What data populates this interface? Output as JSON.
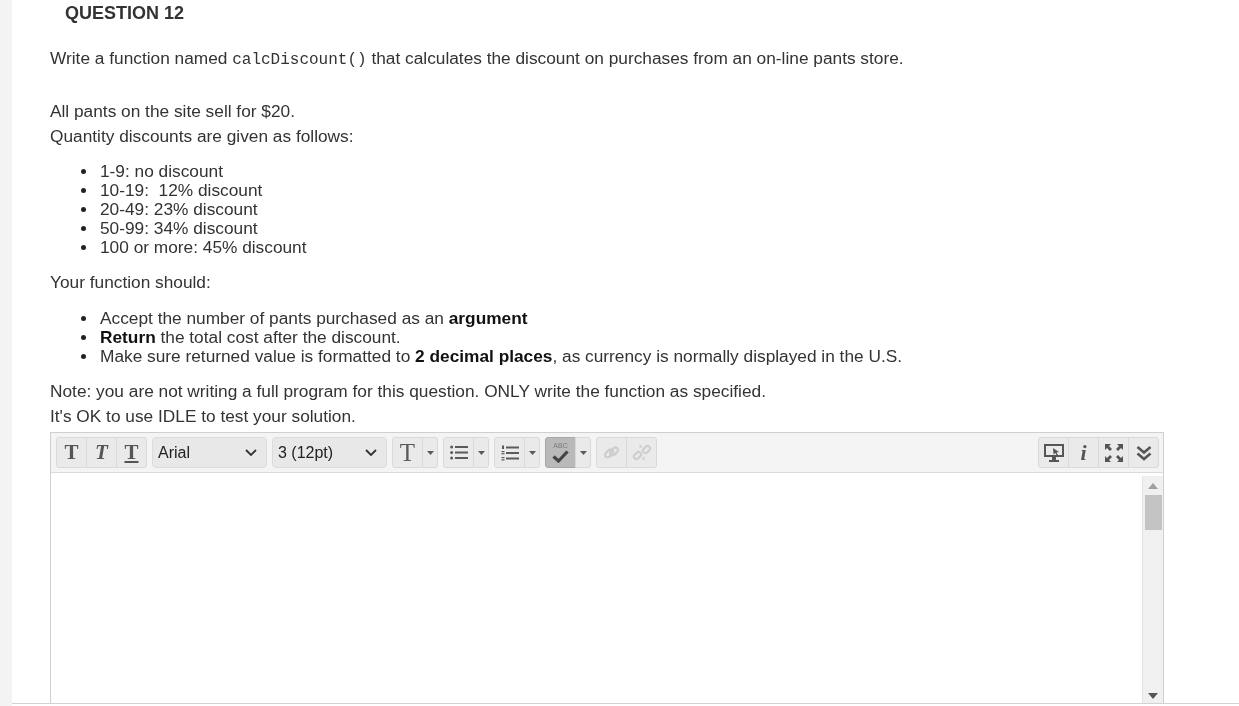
{
  "question": {
    "title": "QUESTION 12",
    "prompt": [
      {
        "kind": "text",
        "text": "Write a function named "
      },
      {
        "kind": "code",
        "text": "calcDiscount()"
      },
      {
        "kind": "text",
        "text": " that calculates the discount on purchases from an on-line pants store."
      }
    ],
    "pricing": [
      "All pants on the site sell for $20.",
      "Quantity discounts are given as follows:"
    ],
    "discounts": [
      "1-9: no discount",
      "10-19:  12% discount",
      "20-49: 23% discount",
      "50-99: 34% discount",
      "100 or more: 45% discount"
    ],
    "requirements_intro": "Your function should:",
    "requirements": [
      "Accept the number of pants purchased as an **argument**",
      "**Return** the total cost after the discount.",
      "Make sure returned value is formatted to **2 decimal places**, as currency is normally displayed in the U.S."
    ],
    "notes": [
      "Note: you are not writing a full program for this question. ONLY write the function as specified.",
      "It's OK to use IDLE to test your solution."
    ]
  },
  "editor": {
    "toolbar": {
      "format_buttons": [
        {
          "kind": "bold",
          "label": "T"
        },
        {
          "kind": "italic",
          "label": "T"
        },
        {
          "kind": "underline",
          "label": "T"
        }
      ],
      "font_family": {
        "value": "Arial"
      },
      "font_size": {
        "value": "3 (12pt)"
      },
      "tool_groups": [
        [
          {
            "kind": "text-color",
            "label": "T",
            "dropdown": true,
            "on": false,
            "disabled": false
          }
        ],
        [
          {
            "kind": "bulleted-list",
            "dropdown": true,
            "on": false,
            "disabled": false
          }
        ],
        [
          {
            "kind": "numbered-list",
            "dropdown": true,
            "on": false,
            "disabled": false
          }
        ],
        [
          {
            "kind": "spellcheck",
            "label": "ABC",
            "dropdown": true,
            "on": true,
            "disabled": false
          }
        ],
        [
          {
            "kind": "link",
            "dropdown": false,
            "on": false,
            "disabled": true
          },
          {
            "kind": "unlink",
            "dropdown": false,
            "on": false,
            "disabled": true
          }
        ]
      ],
      "view_buttons": [
        {
          "kind": "preview"
        },
        {
          "kind": "info",
          "label": "i"
        },
        {
          "kind": "fullscreen"
        },
        {
          "kind": "more"
        }
      ]
    }
  }
}
